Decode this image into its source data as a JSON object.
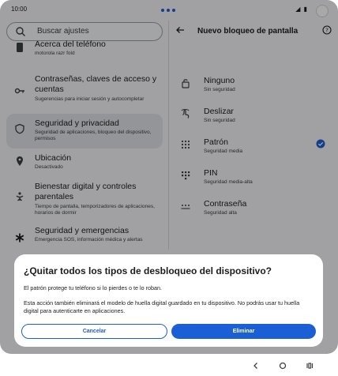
{
  "status": {
    "time": "10:00",
    "icons": "◢ ▮"
  },
  "search": {
    "placeholder": "Buscar ajustes"
  },
  "sidebar": {
    "items": [
      {
        "title": "Acerca del teléfono",
        "subtitle": "motorola razr fold",
        "icon": "phone-icon"
      },
      {
        "title": "Contraseñas, claves de acceso y cuentas",
        "subtitle": "Sugerencias para iniciar sesión y autocompletar",
        "icon": "key-icon"
      },
      {
        "title": "Seguridad y privacidad",
        "subtitle": "Seguridad de aplicaciones, bloqueo del dispositivo, permisos",
        "icon": "shield-icon",
        "selected": true
      },
      {
        "title": "Ubicación",
        "subtitle": "Desactivado",
        "icon": "location-icon"
      },
      {
        "title": "Bienestar digital y controles parentales",
        "subtitle": "Tiempo de pantalla, temporizadores de aplicaciones, horarios de dormir",
        "icon": "wellbeing-icon"
      },
      {
        "title": "Seguridad y emergencias",
        "subtitle": "Emergencia SOS, información médica y alertas",
        "icon": "asterisk-icon"
      }
    ]
  },
  "panel": {
    "title": "Nuevo bloqueo de pantalla",
    "options": [
      {
        "title": "Ninguno",
        "subtitle": "Sin seguridad",
        "icon": "lock-open-icon"
      },
      {
        "title": "Deslizar",
        "subtitle": "Sin seguridad",
        "icon": "swipe-icon"
      },
      {
        "title": "Patrón",
        "subtitle": "Seguridad media",
        "icon": "pattern-icon",
        "checked": true
      },
      {
        "title": "PIN",
        "subtitle": "Seguridad media-alta",
        "icon": "pin-icon"
      },
      {
        "title": "Contraseña",
        "subtitle": "Seguridad alta",
        "icon": "password-icon"
      }
    ]
  },
  "dialog": {
    "title": "¿Quitar todos los tipos de desbloqueo del dispositivo?",
    "message1": "El patrón protege tu teléfono si lo pierdes o te lo roban.",
    "message2": "Esta acción también eliminará el modelo de huella digital guardado en tu dispositivo. No podrás usar tu huella digital para autenticarte en aplicaciones.",
    "cancel_label": "Cancelar",
    "confirm_label": "Eliminar"
  },
  "colors": {
    "accent": "#1b5fd6",
    "surface": "#f4f5f7",
    "selected": "#dfe2e7"
  }
}
